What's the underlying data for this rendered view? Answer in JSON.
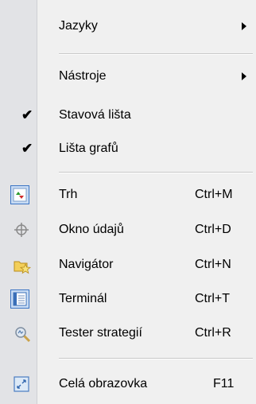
{
  "menu": {
    "items": [
      {
        "label": "Jazyky",
        "submenu": true
      },
      {
        "label": "Nástroje",
        "submenu": true
      },
      {
        "label": "Stavová lišta",
        "checked": true
      },
      {
        "label": "Lišta grafů",
        "checked": true
      },
      {
        "label": "Trh",
        "shortcut": "Ctrl+M",
        "icon": "market-watch-icon"
      },
      {
        "label": "Okno údajů",
        "shortcut": "Ctrl+D",
        "icon": "crosshair-icon"
      },
      {
        "label": "Navigátor",
        "shortcut": "Ctrl+N",
        "icon": "navigator-folder-star-icon"
      },
      {
        "label": "Terminál",
        "shortcut": "Ctrl+T",
        "icon": "terminal-window-icon"
      },
      {
        "label": "Tester strategií",
        "shortcut": "Ctrl+R",
        "icon": "strategy-tester-magnifier-icon"
      },
      {
        "label": "Celá obrazovka",
        "shortcut": "F11",
        "icon": "fullscreen-icon"
      }
    ],
    "check_glyph": "✔",
    "colors": {
      "background": "#f0f0f0",
      "gutter": "#e2e3e6",
      "highlight_box": "#c9dcf4",
      "highlight_border": "#3a74c4"
    }
  }
}
